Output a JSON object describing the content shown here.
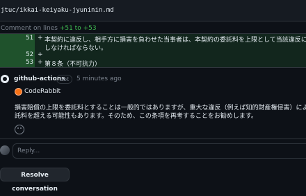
{
  "file": {
    "path": "jtuc/ikkai-keiyaku-jyuninin.md"
  },
  "comment_context": {
    "prefix": "Comment on lines ",
    "range": "+51 to +53"
  },
  "diff_lines": [
    {
      "number": "51",
      "sign": "+",
      "code": "本契約に違反し、相手方に損害を負わせた当事者は、本契約の委託料を上限として当該違反に起因して発生した損害"
    },
    {
      "number": "",
      "sign": "",
      "code": "しなければならない。"
    },
    {
      "number": "52",
      "sign": "+",
      "code": ""
    },
    {
      "number": "53",
      "sign": "+",
      "code": "第８条（不可抗力）"
    }
  ],
  "comment": {
    "author": "github-actions",
    "badge": "bot",
    "timestamp": "5 minutes ago",
    "app_name": "CodeRabbit",
    "body_line_1": "損害賠償の上限を委託料とすることは一般的ではありますが、重大な違反（例えば知的財産権侵害）により発生した損害",
    "body_line_2": "託料を超える可能性もあります。そのため、この条項を再考することをお勧めします。"
  },
  "reply": {
    "placeholder": "Reply..."
  },
  "resolve_button_label": "Resolve conversation",
  "colors": {
    "background": "#0d1117",
    "added_line": "#12261e",
    "added_gutter": "#1f4429",
    "coderabbit": "#f97316"
  }
}
